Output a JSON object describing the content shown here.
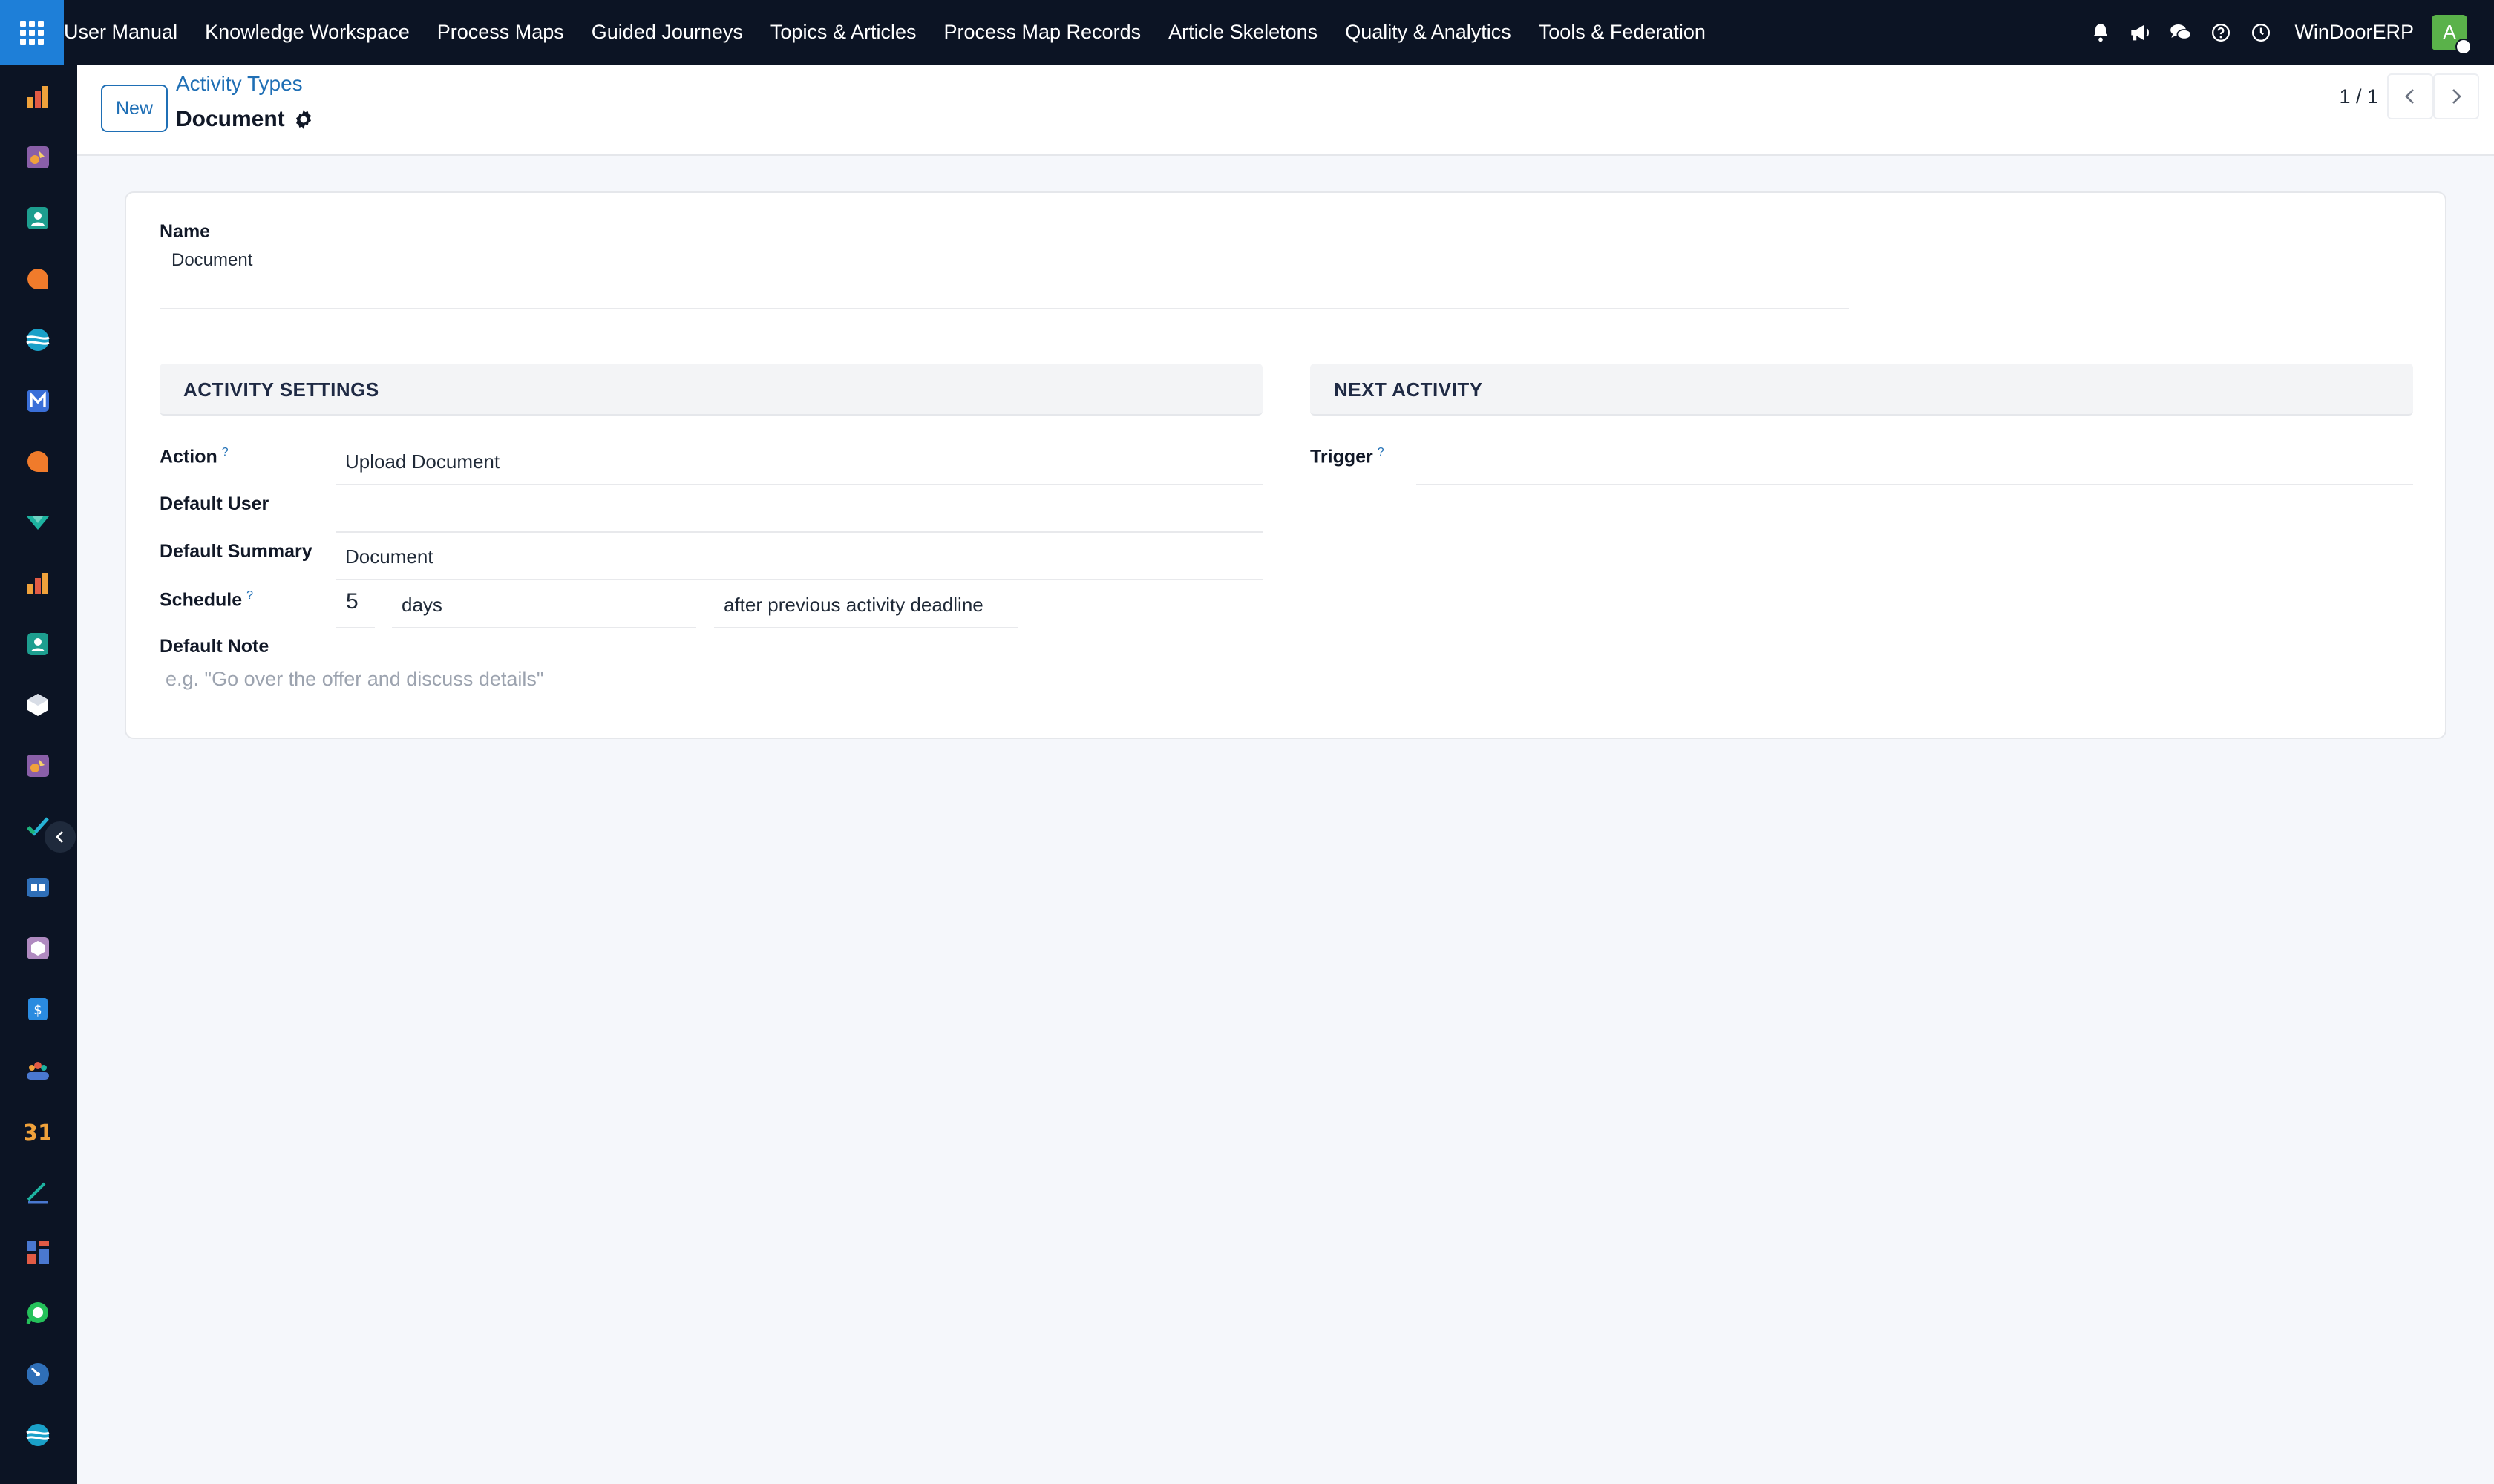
{
  "topbar": {
    "menu": [
      "User Manual",
      "Knowledge Workspace",
      "Process Maps",
      "Guided Journeys",
      "Topics & Articles",
      "Process Map Records",
      "Article Skeletons",
      "Quality & Analytics",
      "Tools & Federation"
    ],
    "company": "WinDoorERP",
    "avatar_letter": "A",
    "icons": [
      "bell-icon",
      "megaphone-icon",
      "chat-icon",
      "help-icon",
      "clock-icon"
    ]
  },
  "control": {
    "new_label": "New",
    "breadcrumb_parent": "Activity Types",
    "breadcrumb_current": "Document",
    "pager": "1 / 1"
  },
  "form": {
    "name_label": "Name",
    "name_value": "Document",
    "activity_settings_title": "ACTIVITY SETTINGS",
    "next_activity_title": "NEXT ACTIVITY",
    "action_label": "Action",
    "action_value": "Upload Document",
    "default_user_label": "Default User",
    "default_user_value": "",
    "default_summary_label": "Default Summary",
    "default_summary_value": "Document",
    "schedule_label": "Schedule",
    "schedule_number": "5",
    "schedule_unit": "days",
    "schedule_ref": "after previous activity deadline",
    "default_note_label": "Default Note",
    "default_note_placeholder": "e.g. \"Go over the offer and discuss details\"",
    "trigger_label": "Trigger",
    "trigger_value": "",
    "help_mark": "?"
  },
  "colors": {
    "topbar_bg": "#0c1424",
    "accent": "#1f6fb5",
    "apps_button": "#1e7fd8",
    "avatar": "#5ab24a"
  }
}
